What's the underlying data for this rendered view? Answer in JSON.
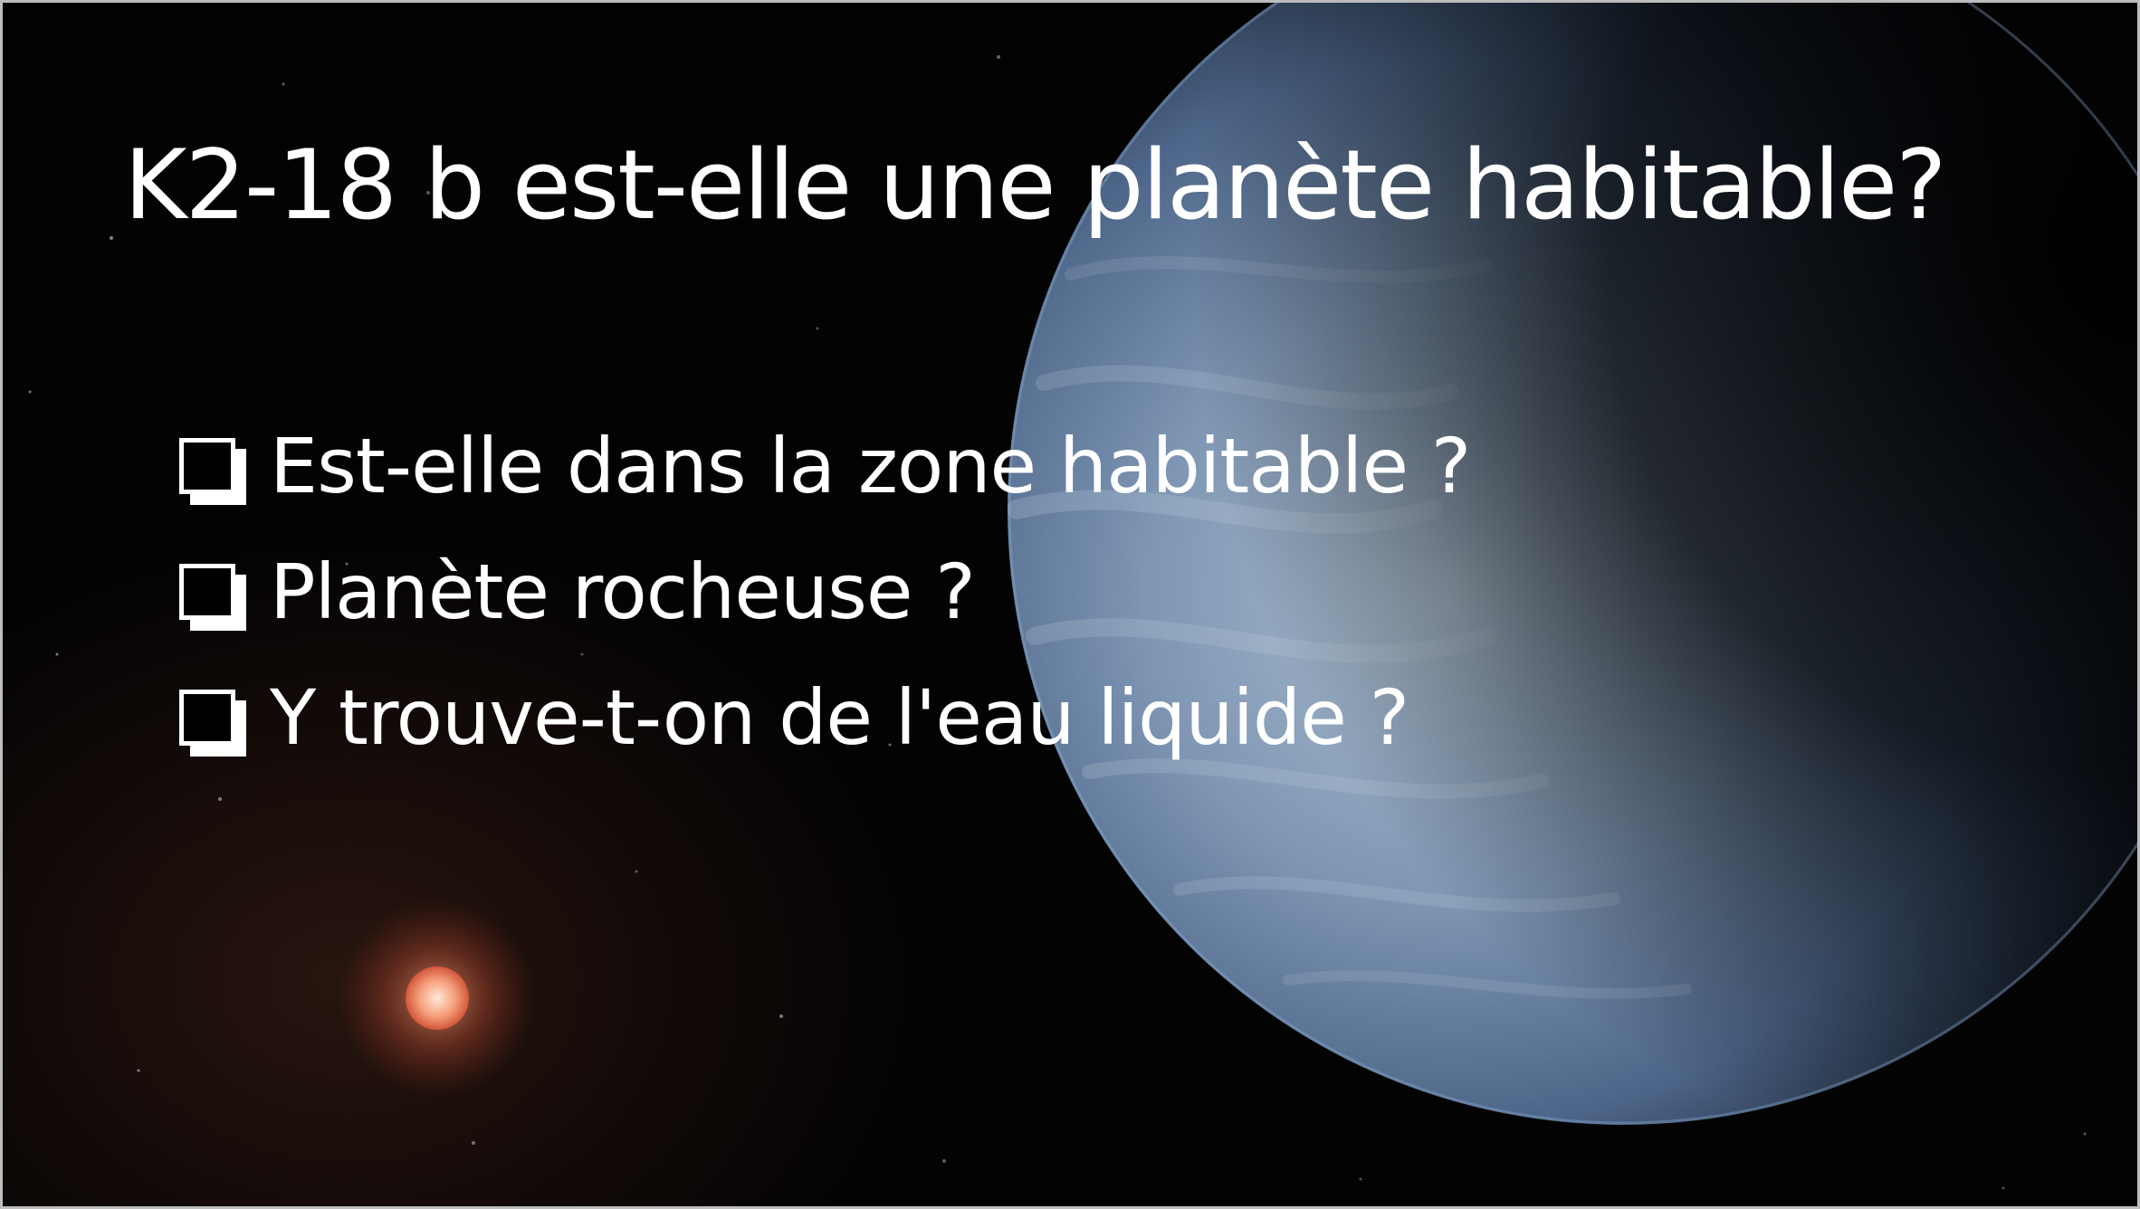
{
  "slide": {
    "title": "K2-18 b est-elle une planète habitable?",
    "bullets": [
      {
        "icon": "checkbox-icon",
        "text": "Est-elle dans la zone habitable ?"
      },
      {
        "icon": "checkbox-icon",
        "text": "Planète rocheuse ?"
      },
      {
        "icon": "checkbox-icon",
        "text": "Y trouve-t-on de l'eau liquide ?"
      }
    ],
    "colors": {
      "background": "#030303",
      "text": "#ffffff",
      "planet": "#5f7fa6",
      "star": "#f28a63"
    }
  }
}
